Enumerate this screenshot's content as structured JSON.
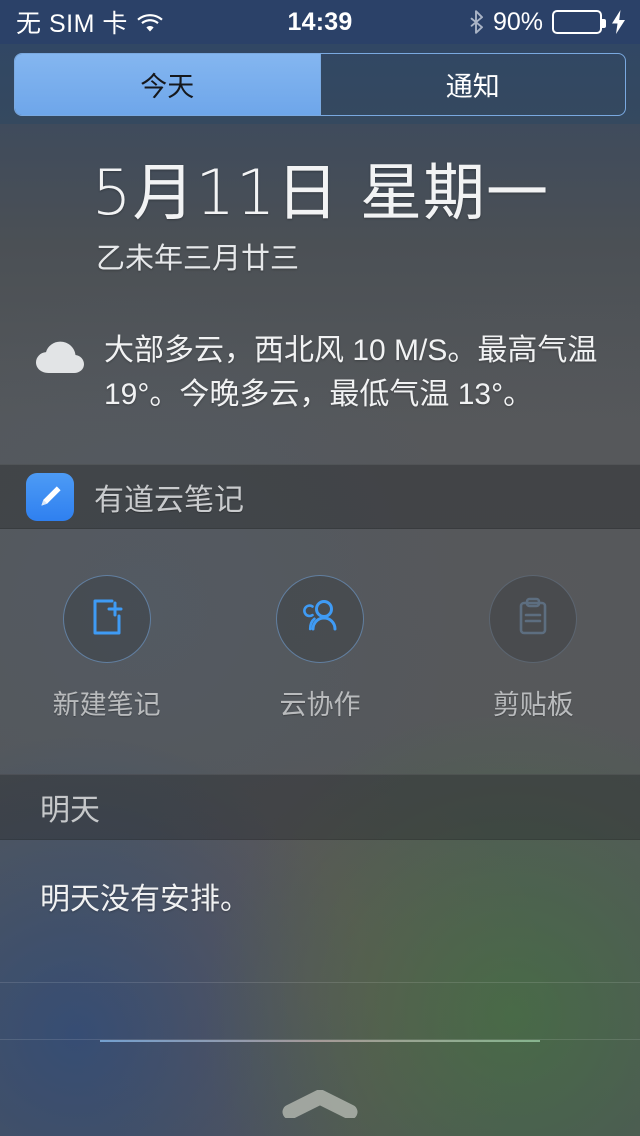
{
  "status_bar": {
    "carrier": "无 SIM 卡",
    "wifi_icon": "wifi-icon",
    "time": "14:39",
    "bluetooth_icon": "bluetooth-icon",
    "battery_percent": "90%",
    "battery_level": 90,
    "battery_color": "#4cd964",
    "charging_icon": "lightning-bolt-icon"
  },
  "tabs": {
    "items": [
      {
        "label": "今天",
        "selected": true
      },
      {
        "label": "通知",
        "selected": false
      }
    ],
    "active_color": "#84b6f0",
    "border_color": "#7aa9e0"
  },
  "today": {
    "date": "5月11日 星期一",
    "lunar_date": "乙未年三月廿三",
    "weather": {
      "icon": "cloud-icon",
      "text": "大部多云，西北风 10 M/S。最高气温 19°。今晚多云，最低气温 13°。",
      "wind": "西北风 10 M/S",
      "high": "19°",
      "low": "13°"
    }
  },
  "youdao_widget": {
    "app_icon": "pencil-icon",
    "app_icon_color": "#3f8ef2",
    "title": "有道云笔记",
    "actions": [
      {
        "label": "新建笔记",
        "icon": "new-note-icon",
        "enabled": true,
        "color": "#3f9bf5"
      },
      {
        "label": "云协作",
        "icon": "people-icon",
        "enabled": true,
        "color": "#3f9bf5"
      },
      {
        "label": "剪贴板",
        "icon": "clipboard-icon",
        "enabled": false,
        "color": "#5d6e80"
      }
    ]
  },
  "tomorrow": {
    "header": "明天",
    "body": "明天没有安排。"
  },
  "grabber": {
    "icon": "chevron-up-grabber-icon"
  }
}
